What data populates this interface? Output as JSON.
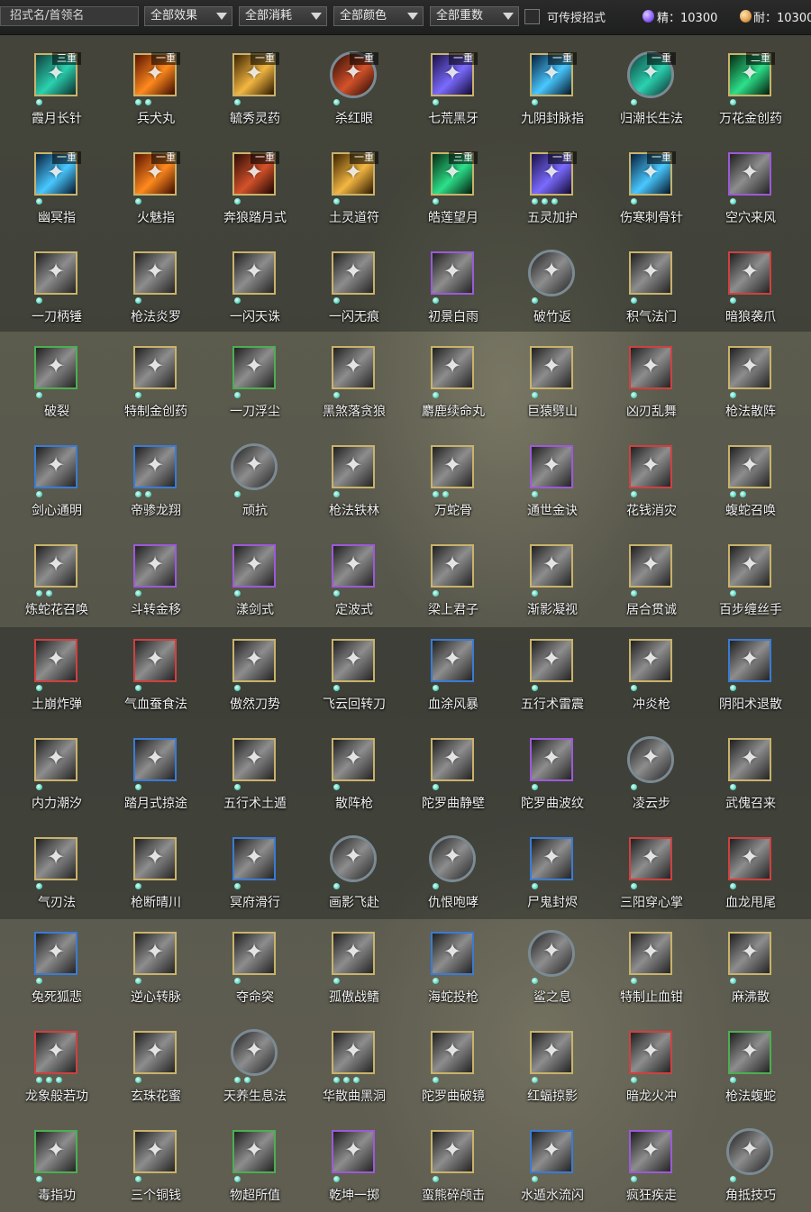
{
  "toolbar": {
    "search_placeholder": "招式名/首领名",
    "filters": [
      "全部效果",
      "全部消耗",
      "全部颜色",
      "全部重数"
    ],
    "transferable_label": "可传授招式",
    "resources": [
      {
        "label": "精：10300",
        "color": "#8a5cff"
      },
      {
        "label": "耐：10300",
        "color": "#e0a050"
      }
    ]
  },
  "colors": {
    "blue": "#3a7bd5",
    "red": "#d04040",
    "purple": "#9c5ad8",
    "gold": "#c9b36a",
    "green": "#4caf50",
    "grey": "#7b8a93"
  },
  "skills": [
    {
      "name": "霞月长针",
      "tier": "三重",
      "dots": 1,
      "border": "gold",
      "shape": "sq",
      "art": "teal",
      "icon": "needle-icon"
    },
    {
      "name": "兵犬丸",
      "tier": "一重",
      "dots": 2,
      "border": "gold",
      "shape": "sq",
      "art": "fire",
      "icon": "pill-icon"
    },
    {
      "name": "毓秀灵药",
      "tier": "一重",
      "dots": 1,
      "border": "gold",
      "shape": "sq",
      "art": "amber",
      "icon": "gourd-icon"
    },
    {
      "name": "杀红眼",
      "tier": "一重",
      "dots": 1,
      "border": "grey",
      "shape": "round",
      "art": "ember",
      "icon": "rage-icon"
    },
    {
      "name": "七荒黑牙",
      "tier": "一重",
      "dots": 1,
      "border": "gold",
      "shape": "sq",
      "art": "violet",
      "icon": "fang-icon"
    },
    {
      "name": "九阴封脉指",
      "tier": "一重",
      "dots": 1,
      "border": "gold",
      "shape": "sq",
      "art": "cyan",
      "icon": "finger-icon"
    },
    {
      "name": "归潮长生法",
      "tier": "一重",
      "dots": 1,
      "border": "grey",
      "shape": "round",
      "art": "teal",
      "icon": "tide-icon"
    },
    {
      "name": "万花金创药",
      "tier": "二重",
      "dots": 1,
      "border": "gold",
      "shape": "sq",
      "art": "green",
      "icon": "flower-icon"
    },
    {
      "name": "幽冥指",
      "tier": "一重",
      "dots": 1,
      "border": "gold",
      "shape": "sq",
      "art": "cyan",
      "icon": "finger-icon"
    },
    {
      "name": "火魅指",
      "tier": "一重",
      "dots": 1,
      "border": "gold",
      "shape": "sq",
      "art": "fire",
      "icon": "flame-icon"
    },
    {
      "name": "奔狼踏月式",
      "tier": "一重",
      "dots": 1,
      "border": "gold",
      "shape": "sq",
      "art": "ember",
      "icon": "wolf-icon"
    },
    {
      "name": "土灵道符",
      "tier": "一重",
      "dots": 1,
      "border": "gold",
      "shape": "sq",
      "art": "amber",
      "icon": "talisman-icon"
    },
    {
      "name": "皓莲望月",
      "tier": "三重",
      "dots": 1,
      "border": "gold",
      "shape": "sq",
      "art": "green",
      "icon": "moon-icon"
    },
    {
      "name": "五灵加护",
      "tier": "一重",
      "dots": 3,
      "border": "gold",
      "shape": "sq",
      "art": "violet",
      "icon": "shield-icon"
    },
    {
      "name": "伤寒刺骨针",
      "tier": "一重",
      "dots": 1,
      "border": "gold",
      "shape": "sq",
      "art": "cyan",
      "icon": "needle-icon"
    },
    {
      "name": "空穴来风",
      "tier": "",
      "dots": 1,
      "border": "purple",
      "shape": "sq",
      "art": "grey",
      "icon": "wind-icon"
    },
    {
      "name": "一刀柄锤",
      "tier": "",
      "dots": 1,
      "border": "gold",
      "shape": "sq",
      "art": "grey",
      "icon": "hammer-icon"
    },
    {
      "name": "枪法炎罗",
      "tier": "",
      "dots": 1,
      "border": "gold",
      "shape": "sq",
      "art": "grey",
      "icon": "spear-icon"
    },
    {
      "name": "一闪天诛",
      "tier": "",
      "dots": 1,
      "border": "gold",
      "shape": "sq",
      "art": "grey",
      "icon": "slash-icon"
    },
    {
      "name": "一闪无痕",
      "tier": "",
      "dots": 1,
      "border": "gold",
      "shape": "sq",
      "art": "grey",
      "icon": "slash-icon"
    },
    {
      "name": "初景白雨",
      "tier": "",
      "dots": 1,
      "border": "purple",
      "shape": "sq",
      "art": "grey",
      "icon": "rain-icon"
    },
    {
      "name": "破竹返",
      "tier": "",
      "dots": 1,
      "border": "grey",
      "shape": "round",
      "art": "grey",
      "icon": "counter-icon"
    },
    {
      "name": "积气法门",
      "tier": "",
      "dots": 1,
      "border": "gold",
      "shape": "sq",
      "art": "grey",
      "icon": "qi-icon"
    },
    {
      "name": "暗狼袭爪",
      "tier": "",
      "dots": 1,
      "border": "red",
      "shape": "sq",
      "art": "grey",
      "icon": "claw-icon"
    },
    {
      "name": "破裂",
      "tier": "",
      "dots": 1,
      "border": "green",
      "shape": "sq",
      "art": "grey",
      "icon": "shatter-icon"
    },
    {
      "name": "特制金创药",
      "tier": "",
      "dots": 1,
      "border": "gold",
      "shape": "sq",
      "art": "grey",
      "icon": "medicine-icon"
    },
    {
      "name": "一刀浮尘",
      "tier": "",
      "dots": 1,
      "border": "green",
      "shape": "sq",
      "art": "grey",
      "icon": "blade-icon"
    },
    {
      "name": "黑煞落贪狼",
      "tier": "",
      "dots": 1,
      "border": "gold",
      "shape": "sq",
      "art": "grey",
      "icon": "wolf-icon"
    },
    {
      "name": "麝鹿续命丸",
      "tier": "",
      "dots": 1,
      "border": "gold",
      "shape": "sq",
      "art": "grey",
      "icon": "pill-icon"
    },
    {
      "name": "巨猿劈山",
      "tier": "",
      "dots": 1,
      "border": "gold",
      "shape": "sq",
      "art": "grey",
      "icon": "ape-icon"
    },
    {
      "name": "凶刃乱舞",
      "tier": "",
      "dots": 1,
      "border": "red",
      "shape": "sq",
      "art": "grey",
      "icon": "blade-icon"
    },
    {
      "name": "枪法散阵",
      "tier": "",
      "dots": 1,
      "border": "gold",
      "shape": "sq",
      "art": "grey",
      "icon": "spear-icon"
    },
    {
      "name": "剑心通明",
      "tier": "",
      "dots": 1,
      "border": "blue",
      "shape": "sq",
      "art": "grey",
      "icon": "sword-icon"
    },
    {
      "name": "帝骖龙翔",
      "tier": "",
      "dots": 2,
      "border": "blue",
      "shape": "sq",
      "art": "grey",
      "icon": "dragon-icon"
    },
    {
      "name": "顽抗",
      "tier": "",
      "dots": 1,
      "border": "grey",
      "shape": "round",
      "art": "grey",
      "icon": "resist-icon"
    },
    {
      "name": "枪法铁林",
      "tier": "",
      "dots": 1,
      "border": "gold",
      "shape": "sq",
      "art": "grey",
      "icon": "spear-icon"
    },
    {
      "name": "万蛇骨",
      "tier": "",
      "dots": 2,
      "border": "gold",
      "shape": "sq",
      "art": "grey",
      "icon": "snake-icon"
    },
    {
      "name": "通世金诀",
      "tier": "",
      "dots": 1,
      "border": "purple",
      "shape": "sq",
      "art": "grey",
      "icon": "coin-icon"
    },
    {
      "name": "花钱消灾",
      "tier": "",
      "dots": 1,
      "border": "red",
      "shape": "sq",
      "art": "grey",
      "icon": "coin-icon"
    },
    {
      "name": "蝮蛇召唤",
      "tier": "",
      "dots": 2,
      "border": "gold",
      "shape": "sq",
      "art": "grey",
      "icon": "snake-icon"
    },
    {
      "name": "炼蛇花召唤",
      "tier": "",
      "dots": 2,
      "border": "gold",
      "shape": "sq",
      "art": "grey",
      "icon": "snake-icon"
    },
    {
      "name": "斗转金移",
      "tier": "",
      "dots": 1,
      "border": "purple",
      "shape": "sq",
      "art": "grey",
      "icon": "swirl-icon"
    },
    {
      "name": "漾剑式",
      "tier": "",
      "dots": 1,
      "border": "purple",
      "shape": "sq",
      "art": "grey",
      "icon": "sword-icon"
    },
    {
      "name": "定波式",
      "tier": "",
      "dots": 1,
      "border": "purple",
      "shape": "sq",
      "art": "grey",
      "icon": "wave-icon"
    },
    {
      "name": "梁上君子",
      "tier": "",
      "dots": 1,
      "border": "gold",
      "shape": "sq",
      "art": "grey",
      "icon": "thief-icon"
    },
    {
      "name": "渐影凝视",
      "tier": "",
      "dots": 1,
      "border": "gold",
      "shape": "sq",
      "art": "grey",
      "icon": "eye-icon"
    },
    {
      "name": "居合贯诚",
      "tier": "",
      "dots": 1,
      "border": "gold",
      "shape": "sq",
      "art": "grey",
      "icon": "blade-icon"
    },
    {
      "name": "百步缠丝手",
      "tier": "",
      "dots": 1,
      "border": "gold",
      "shape": "sq",
      "art": "grey",
      "icon": "hand-icon"
    },
    {
      "name": "土崩炸弹",
      "tier": "",
      "dots": 1,
      "border": "red",
      "shape": "sq",
      "art": "grey",
      "icon": "bomb-icon"
    },
    {
      "name": "气血蚕食法",
      "tier": "",
      "dots": 1,
      "border": "red",
      "shape": "sq",
      "art": "grey",
      "icon": "blood-icon"
    },
    {
      "name": "傲然刀势",
      "tier": "",
      "dots": 1,
      "border": "gold",
      "shape": "sq",
      "art": "grey",
      "icon": "blade-icon"
    },
    {
      "name": "飞云回转刀",
      "tier": "",
      "dots": 1,
      "border": "gold",
      "shape": "sq",
      "art": "grey",
      "icon": "blade-icon"
    },
    {
      "name": "血涂风暴",
      "tier": "",
      "dots": 1,
      "border": "blue",
      "shape": "sq",
      "art": "grey",
      "icon": "storm-icon"
    },
    {
      "name": "五行术雷震",
      "tier": "",
      "dots": 1,
      "border": "gold",
      "shape": "sq",
      "art": "grey",
      "icon": "thunder-icon"
    },
    {
      "name": "冲炎枪",
      "tier": "",
      "dots": 1,
      "border": "gold",
      "shape": "sq",
      "art": "grey",
      "icon": "spear-icon"
    },
    {
      "name": "阴阳术退散",
      "tier": "",
      "dots": 1,
      "border": "blue",
      "shape": "sq",
      "art": "grey",
      "icon": "yinyang-icon"
    },
    {
      "name": "内力潮汐",
      "tier": "",
      "dots": 1,
      "border": "gold",
      "shape": "sq",
      "art": "grey",
      "icon": "tide-icon"
    },
    {
      "name": "踏月式掠途",
      "tier": "",
      "dots": 1,
      "border": "blue",
      "shape": "sq",
      "art": "grey",
      "icon": "moon-icon"
    },
    {
      "name": "五行术土遁",
      "tier": "",
      "dots": 1,
      "border": "gold",
      "shape": "sq",
      "art": "grey",
      "icon": "earth-icon"
    },
    {
      "name": "散阵枪",
      "tier": "",
      "dots": 1,
      "border": "gold",
      "shape": "sq",
      "art": "grey",
      "icon": "spear-icon"
    },
    {
      "name": "陀罗曲静壁",
      "tier": "",
      "dots": 1,
      "border": "gold",
      "shape": "sq",
      "art": "grey",
      "icon": "wall-icon"
    },
    {
      "name": "陀罗曲波纹",
      "tier": "",
      "dots": 1,
      "border": "purple",
      "shape": "sq",
      "art": "grey",
      "icon": "wave-icon"
    },
    {
      "name": "凌云步",
      "tier": "",
      "dots": 1,
      "border": "grey",
      "shape": "round",
      "art": "grey",
      "icon": "step-icon"
    },
    {
      "name": "武傀召来",
      "tier": "",
      "dots": 1,
      "border": "gold",
      "shape": "sq",
      "art": "grey",
      "icon": "puppet-icon"
    },
    {
      "name": "气刃法",
      "tier": "",
      "dots": 1,
      "border": "gold",
      "shape": "sq",
      "art": "grey",
      "icon": "wind-icon"
    },
    {
      "name": "枪断晴川",
      "tier": "",
      "dots": 1,
      "border": "gold",
      "shape": "sq",
      "art": "grey",
      "icon": "spear-icon"
    },
    {
      "name": "冥府滑行",
      "tier": "",
      "dots": 1,
      "border": "blue",
      "shape": "sq",
      "art": "grey",
      "icon": "dash-icon"
    },
    {
      "name": "画影飞赴",
      "tier": "",
      "dots": 1,
      "border": "grey",
      "shape": "round",
      "art": "grey",
      "icon": "dash-icon"
    },
    {
      "name": "仇恨咆哮",
      "tier": "",
      "dots": 1,
      "border": "grey",
      "shape": "round",
      "art": "grey",
      "icon": "roar-icon"
    },
    {
      "name": "尸鬼封烬",
      "tier": "",
      "dots": 1,
      "border": "blue",
      "shape": "sq",
      "art": "grey",
      "icon": "seal-icon"
    },
    {
      "name": "三阳穿心掌",
      "tier": "",
      "dots": 1,
      "border": "red",
      "shape": "sq",
      "art": "grey",
      "icon": "palm-icon"
    },
    {
      "name": "血龙甩尾",
      "tier": "",
      "dots": 1,
      "border": "red",
      "shape": "sq",
      "art": "grey",
      "icon": "dragon-icon"
    },
    {
      "name": "兔死狐悲",
      "tier": "",
      "dots": 1,
      "border": "blue",
      "shape": "sq",
      "art": "grey",
      "icon": "fox-icon"
    },
    {
      "name": "逆心转脉",
      "tier": "",
      "dots": 1,
      "border": "gold",
      "shape": "sq",
      "art": "grey",
      "icon": "heart-icon"
    },
    {
      "name": "夺命突",
      "tier": "",
      "dots": 1,
      "border": "gold",
      "shape": "sq",
      "art": "grey",
      "icon": "thrust-icon"
    },
    {
      "name": "孤傲战鳍",
      "tier": "",
      "dots": 1,
      "border": "gold",
      "shape": "sq",
      "art": "grey",
      "icon": "fin-icon"
    },
    {
      "name": "海蛇投枪",
      "tier": "",
      "dots": 1,
      "border": "blue",
      "shape": "sq",
      "art": "grey",
      "icon": "spear-icon"
    },
    {
      "name": "鲨之息",
      "tier": "",
      "dots": 1,
      "border": "grey",
      "shape": "round",
      "art": "grey",
      "icon": "shark-icon"
    },
    {
      "name": "特制止血钳",
      "tier": "",
      "dots": 1,
      "border": "gold",
      "shape": "sq",
      "art": "grey",
      "icon": "clamp-icon"
    },
    {
      "name": "麻沸散",
      "tier": "",
      "dots": 1,
      "border": "gold",
      "shape": "sq",
      "art": "grey",
      "icon": "powder-icon"
    },
    {
      "name": "龙象般若功",
      "tier": "",
      "dots": 3,
      "border": "red",
      "shape": "sq",
      "art": "grey",
      "icon": "elephant-icon"
    },
    {
      "name": "玄珠花蜜",
      "tier": "",
      "dots": 1,
      "border": "gold",
      "shape": "sq",
      "art": "grey",
      "icon": "honey-icon"
    },
    {
      "name": "天养生息法",
      "tier": "",
      "dots": 2,
      "border": "grey",
      "shape": "round",
      "art": "grey",
      "icon": "meditate-icon"
    },
    {
      "name": "华散曲黑洞",
      "tier": "",
      "dots": 3,
      "border": "gold",
      "shape": "sq",
      "art": "grey",
      "icon": "vortex-icon"
    },
    {
      "name": "陀罗曲破镜",
      "tier": "",
      "dots": 1,
      "border": "gold",
      "shape": "sq",
      "art": "grey",
      "icon": "mirror-icon"
    },
    {
      "name": "红蝠掠影",
      "tier": "",
      "dots": 1,
      "border": "gold",
      "shape": "sq",
      "art": "grey",
      "icon": "bat-icon"
    },
    {
      "name": "暗龙火冲",
      "tier": "",
      "dots": 1,
      "border": "red",
      "shape": "sq",
      "art": "grey",
      "icon": "fire-icon"
    },
    {
      "name": "枪法蝮蛇",
      "tier": "",
      "dots": 1,
      "border": "green",
      "shape": "sq",
      "art": "grey",
      "icon": "spear-icon"
    },
    {
      "name": "毒指功",
      "tier": "",
      "dots": 1,
      "border": "green",
      "shape": "sq",
      "art": "grey",
      "icon": "poison-icon"
    },
    {
      "name": "三个铜钱",
      "tier": "",
      "dots": 1,
      "border": "gold",
      "shape": "sq",
      "art": "grey",
      "icon": "coin-icon"
    },
    {
      "name": "物超所值",
      "tier": "",
      "dots": 1,
      "border": "green",
      "shape": "sq",
      "art": "grey",
      "icon": "value-icon"
    },
    {
      "name": "乾坤一掷",
      "tier": "",
      "dots": 1,
      "border": "purple",
      "shape": "sq",
      "art": "grey",
      "icon": "throw-icon"
    },
    {
      "name": "蛮熊碎颅击",
      "tier": "",
      "dots": 1,
      "border": "gold",
      "shape": "sq",
      "art": "grey",
      "icon": "bear-icon"
    },
    {
      "name": "水遁水流闪",
      "tier": "",
      "dots": 1,
      "border": "blue",
      "shape": "sq",
      "art": "grey",
      "icon": "water-icon"
    },
    {
      "name": "疯狂疾走",
      "tier": "",
      "dots": 1,
      "border": "purple",
      "shape": "sq",
      "art": "grey",
      "icon": "run-icon"
    },
    {
      "name": "角抵技巧",
      "tier": "",
      "dots": 1,
      "border": "grey",
      "shape": "round",
      "art": "grey",
      "icon": "wrestle-icon"
    }
  ]
}
